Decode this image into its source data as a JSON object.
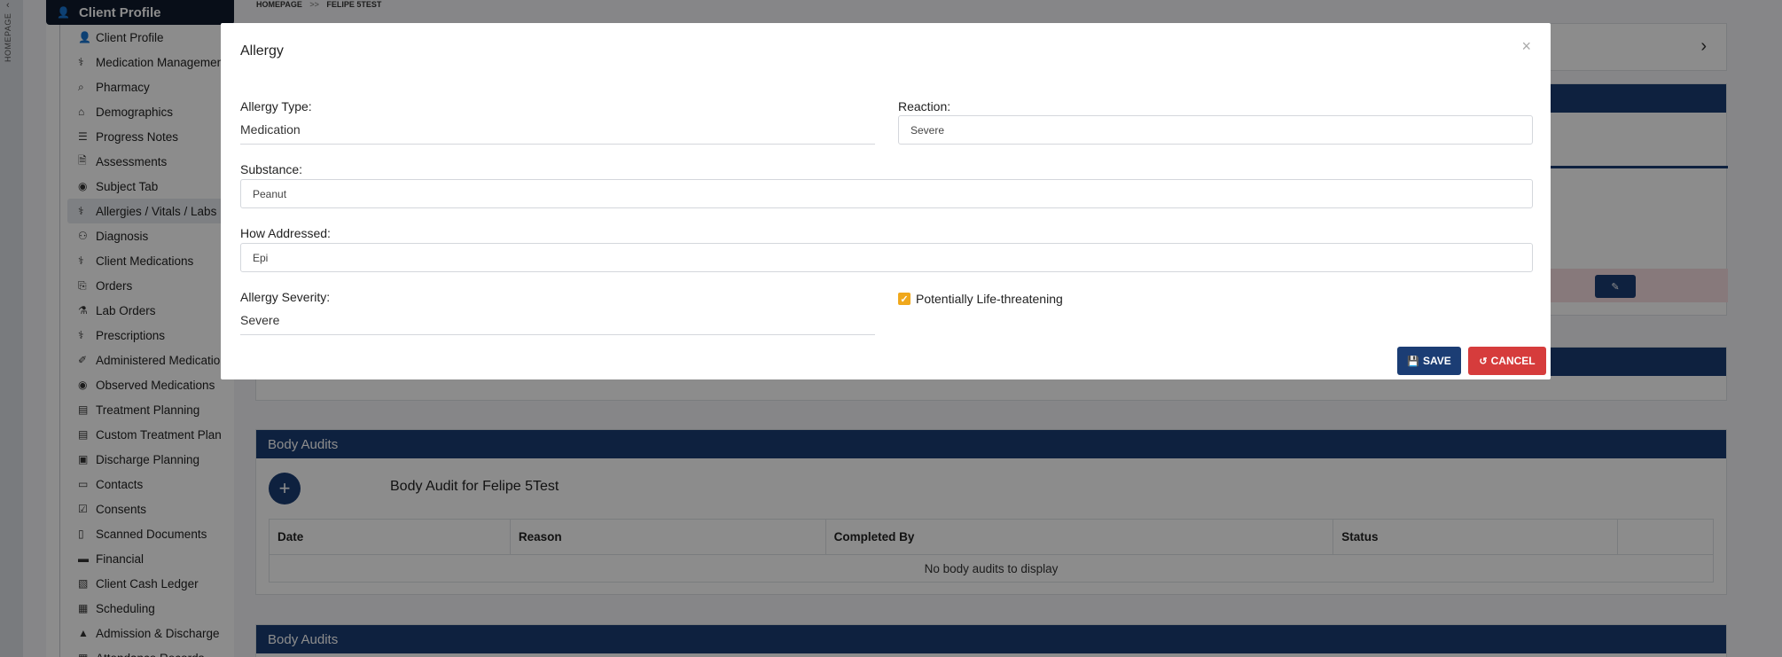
{
  "rail": {
    "label": "HOMEPAGE"
  },
  "sidebar": {
    "header": "Client Profile",
    "items": [
      {
        "label": "Client Profile",
        "icon": "person-icon"
      },
      {
        "label": "Medication Management",
        "icon": "medkit-icon"
      },
      {
        "label": "Pharmacy",
        "icon": "search-icon"
      },
      {
        "label": "Demographics",
        "icon": "home-icon"
      },
      {
        "label": "Progress Notes",
        "icon": "list-icon"
      },
      {
        "label": "Assessments",
        "icon": "document-icon"
      },
      {
        "label": "Subject Tab",
        "icon": "eye-icon"
      },
      {
        "label": "Allergies / Vitals / Labs",
        "icon": "stethoscope-icon"
      },
      {
        "label": "Diagnosis",
        "icon": "user-md-icon"
      },
      {
        "label": "Client Medications",
        "icon": "medkit-icon"
      },
      {
        "label": "Orders",
        "icon": "clipboard-icon"
      },
      {
        "label": "Lab Orders",
        "icon": "flask-icon"
      },
      {
        "label": "Prescriptions",
        "icon": "medkit-icon"
      },
      {
        "label": "Administered Medications",
        "icon": "syringe-icon"
      },
      {
        "label": "Observed Medications",
        "icon": "eye-icon"
      },
      {
        "label": "Treatment Planning",
        "icon": "book-icon"
      },
      {
        "label": "Custom Treatment Plan",
        "icon": "book-icon"
      },
      {
        "label": "Discharge Planning",
        "icon": "briefcase-icon"
      },
      {
        "label": "Contacts",
        "icon": "id-card-icon"
      },
      {
        "label": "Consents",
        "icon": "check-square-icon"
      },
      {
        "label": "Scanned Documents",
        "icon": "file-icon"
      },
      {
        "label": "Financial",
        "icon": "credit-card-icon"
      },
      {
        "label": "Client Cash Ledger",
        "icon": "money-icon"
      },
      {
        "label": "Scheduling",
        "icon": "calendar-icon"
      },
      {
        "label": "Admission & Discharge",
        "icon": "car-icon"
      },
      {
        "label": "Attendance Records",
        "icon": "calendar-icon"
      }
    ]
  },
  "breadcrumb": {
    "home": "HOMEPAGE",
    "sep": ">>",
    "current": "FELIPE 5TEST"
  },
  "body_audits": {
    "header": "Body Audits",
    "title": "Body Audit for Felipe 5Test",
    "columns": [
      "Date",
      "Reason",
      "Completed By",
      "Status",
      ""
    ],
    "empty": "No body audits to display"
  },
  "body_audits_2": {
    "header": "Body Audits"
  },
  "modal": {
    "title": "Allergy",
    "close": "×",
    "allergy_type_label": "Allergy Type:",
    "allergy_type_value": "Medication",
    "reaction_label": "Reaction:",
    "reaction_value": "Severe",
    "substance_label": "Substance:",
    "substance_value": "Peanut",
    "how_addressed_label": "How Addressed:",
    "how_addressed_value": "Epi",
    "severity_label": "Allergy Severity:",
    "severity_value": "Severe",
    "life_threatening_label": "Potentially Life-threatening",
    "life_threatening_checked": true,
    "save": "SAVE",
    "cancel": "CANCEL"
  },
  "colors": {
    "primary": "#1b3d74",
    "danger": "#d63c3c",
    "checkbox": "#f0a81c",
    "sidebar_header": "#0f1b2d"
  }
}
